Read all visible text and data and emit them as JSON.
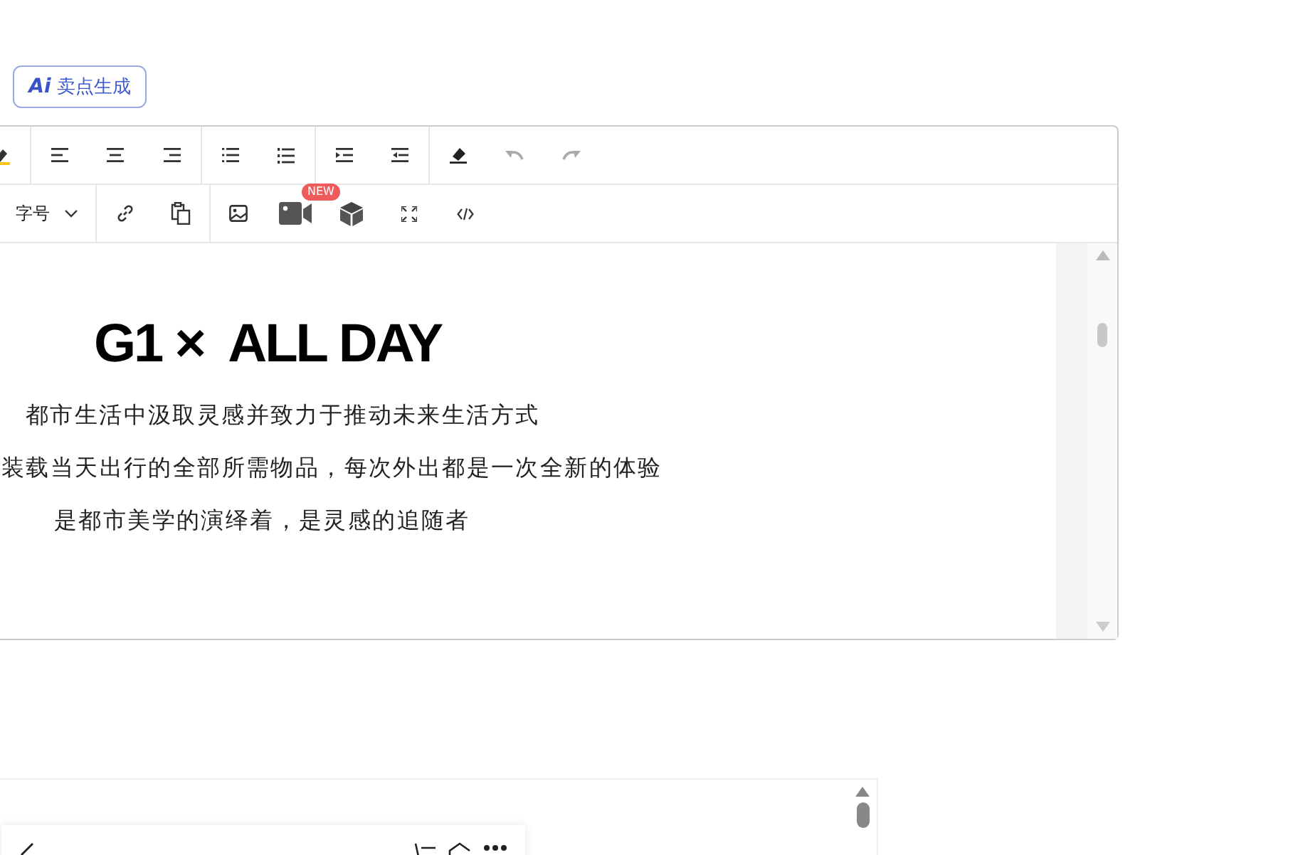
{
  "ai_button": {
    "badge": "Ai",
    "label": "卖点生成"
  },
  "toolbar": {
    "undo": {
      "disabled": true
    },
    "redo": {
      "disabled": true
    },
    "font_size_select": {
      "value": "字号"
    },
    "video_badge": "NEW"
  },
  "document": {
    "heading": "G1 ×  ALL DAY",
    "paragraphs": [
      "都市生活中汲取灵感并致力于推动未来生活方式",
      "装载当天出行的全部所需物品，每次外出都是一次全新的体验",
      "是都市美学的演绎着，是灵感的追随者"
    ]
  }
}
